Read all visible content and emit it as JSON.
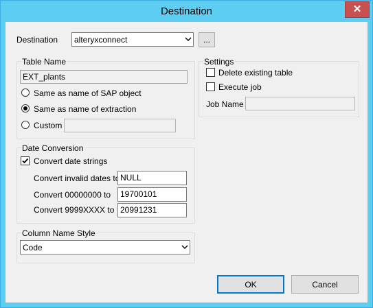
{
  "window": {
    "title": "Destination",
    "close_label": "✕"
  },
  "destination": {
    "label": "Destination",
    "value": "alteryxconnect",
    "browse_label": "..."
  },
  "table_name": {
    "group_label": "Table Name",
    "value": "EXT_plants",
    "options": [
      {
        "label": "Same as name of SAP object",
        "selected": false
      },
      {
        "label": "Same as name of extraction",
        "selected": true
      },
      {
        "label": "Custom",
        "selected": false
      }
    ],
    "custom_value": ""
  },
  "settings": {
    "group_label": "Settings",
    "delete_existing_label": "Delete existing table",
    "delete_existing_checked": false,
    "execute_job_label": "Execute job",
    "execute_job_checked": false,
    "job_name_label": "Job Name",
    "job_name_value": ""
  },
  "date_conversion": {
    "group_label": "Date Conversion",
    "convert_label": "Convert date strings",
    "convert_checked": true,
    "invalid_label": "Convert invalid dates to",
    "invalid_value": "NULL",
    "zero_label": "Convert 00000000 to",
    "zero_value": "19700101",
    "nines_label": "Convert 9999XXXX to",
    "nines_value": "20991231"
  },
  "column_name_style": {
    "group_label": "Column Name Style",
    "value": "Code"
  },
  "buttons": {
    "ok": "OK",
    "cancel": "Cancel"
  },
  "colors": {
    "titlebar": "#5ecdf2",
    "close": "#c75050",
    "dialog": "#f0f0f0",
    "focus_border": "#0078d7"
  },
  "icons": {
    "dropdown": "chevron-down-icon",
    "check": "checkmark-icon",
    "close": "close-icon"
  }
}
